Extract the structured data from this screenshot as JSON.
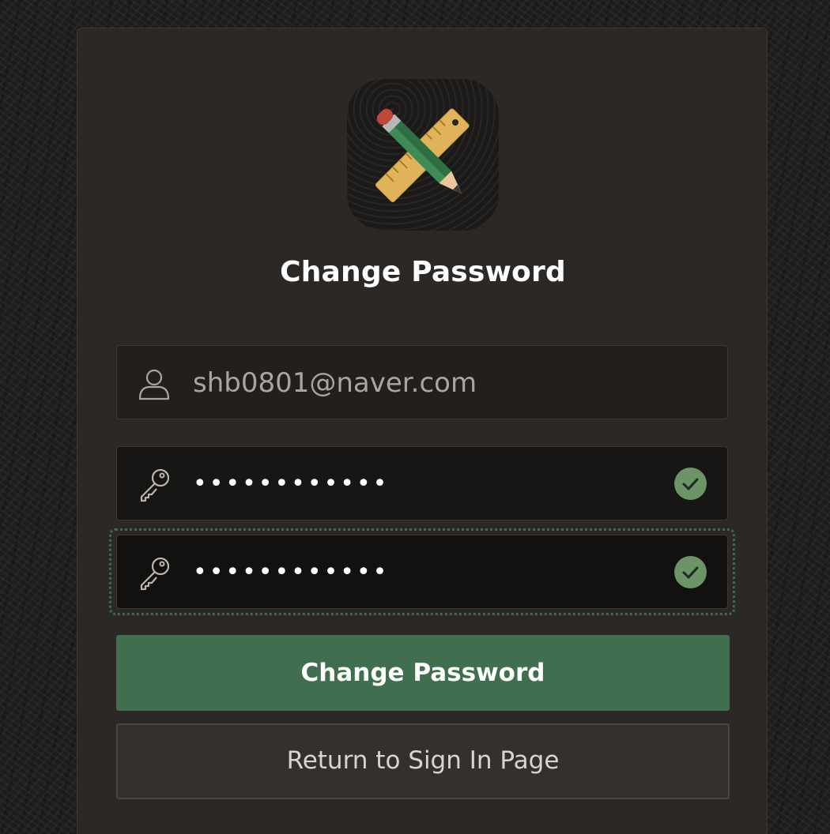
{
  "page": {
    "title": "Change Password",
    "app_icon": "pencil-ruler-icon"
  },
  "form": {
    "username": {
      "value": "shb0801@naver.com",
      "icon": "user-icon"
    },
    "new_password": {
      "value": "••••••••••••",
      "icon": "key-icon",
      "status_icon": "check-icon"
    },
    "confirm_password": {
      "value": "••••••••••••",
      "icon": "key-icon",
      "status_icon": "check-icon"
    }
  },
  "buttons": {
    "change_label": "Change Password",
    "return_label": "Return to Sign In Page"
  },
  "colors": {
    "primary_button": "#3f6f4f",
    "valid_check": "#6d9466",
    "card": "#2b2825"
  }
}
